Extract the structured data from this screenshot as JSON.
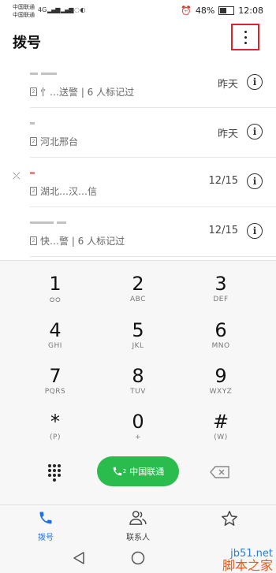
{
  "status_bar": {
    "carrier_1": "中国联通",
    "carrier_2": "中国联通",
    "signal_1": "4G",
    "battery_percent": "48%",
    "battery_level": 0.48,
    "time": "12:08"
  },
  "header": {
    "title": "拨号",
    "more_icon": "more-vert-icon"
  },
  "call_log": [
    {
      "sub": "忄…送警 | 6 人标记过",
      "date": "昨天",
      "missed": false
    },
    {
      "sub": "河北邢台",
      "date": "昨天",
      "missed": false
    },
    {
      "sub": "湖北…汉…信",
      "date": "12/15",
      "missed": true
    },
    {
      "sub": "快…警 | 6 人标记过",
      "date": "12/15",
      "missed": false
    }
  ],
  "keypad": {
    "keys": [
      {
        "digit": "1",
        "letters": "voicemail"
      },
      {
        "digit": "2",
        "letters": "ABC"
      },
      {
        "digit": "3",
        "letters": "DEF"
      },
      {
        "digit": "4",
        "letters": "GHI"
      },
      {
        "digit": "5",
        "letters": "JKL"
      },
      {
        "digit": "6",
        "letters": "MNO"
      },
      {
        "digit": "7",
        "letters": "PQRS"
      },
      {
        "digit": "8",
        "letters": "TUV"
      },
      {
        "digit": "9",
        "letters": "WXYZ"
      },
      {
        "digit": "*",
        "letters": "(P)"
      },
      {
        "digit": "0",
        "letters": "+"
      },
      {
        "digit": "#",
        "letters": "(W)"
      }
    ],
    "call_label": "中国联通",
    "call_sim": "2"
  },
  "tabs": [
    {
      "label": "拨号",
      "icon": "phone-icon",
      "active": true
    },
    {
      "label": "联系人",
      "icon": "contacts-icon",
      "active": false
    },
    {
      "label": "",
      "icon": "star-icon",
      "active": false
    }
  ],
  "watermark": {
    "line1": "jb51.net",
    "line2": "脚本之家"
  },
  "colors": {
    "accent": "#1a73e8",
    "call_green": "#2bbc4e",
    "highlight_red": "#d8262c"
  }
}
